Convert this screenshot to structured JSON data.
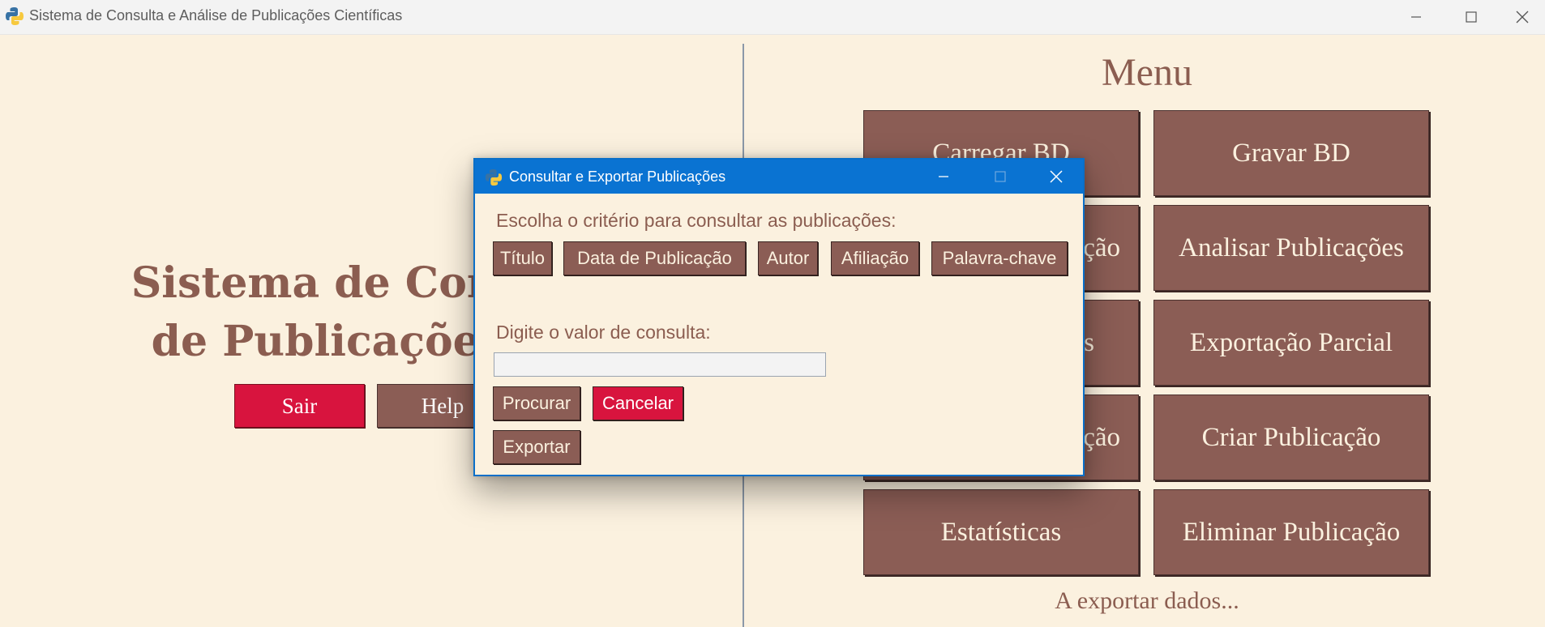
{
  "window": {
    "title": "Sistema de Consulta e Análise de Publicações Científicas",
    "controls": [
      "minimize-icon",
      "maximize-icon",
      "close-icon"
    ]
  },
  "left": {
    "title_line1": "Sistema de Consulta",
    "title_line2": "de Publicações Cie",
    "sair_label": "Sair",
    "help_label": "Help"
  },
  "menu": {
    "title": "Menu",
    "buttons": [
      "Carregar BD",
      "Gravar BD",
      "ção",
      "Analisar Publicações",
      "s",
      "Exportação Parcial",
      "ção",
      "Criar Publicação",
      "Estatísticas",
      "Eliminar Publicação"
    ],
    "status": "A exportar dados..."
  },
  "dialog": {
    "title": "Consultar e Exportar Publicações",
    "criteria_prompt": "Escolha o critério para consultar as publicações:",
    "criteria": [
      "Título",
      "Data de Publicação",
      "Autor",
      "Afiliação",
      "Palavra-chave"
    ],
    "value_prompt": "Digite o valor de consulta:",
    "value": "",
    "search_label": "Procurar",
    "cancel_label": "Cancelar",
    "export_label": "Exportar"
  },
  "colors": {
    "background": "#fbf1df",
    "button_brown": "#8b5d55",
    "button_red": "#d8143e",
    "accent_blue": "#0a73d2",
    "title_brown": "#8b5d50"
  }
}
